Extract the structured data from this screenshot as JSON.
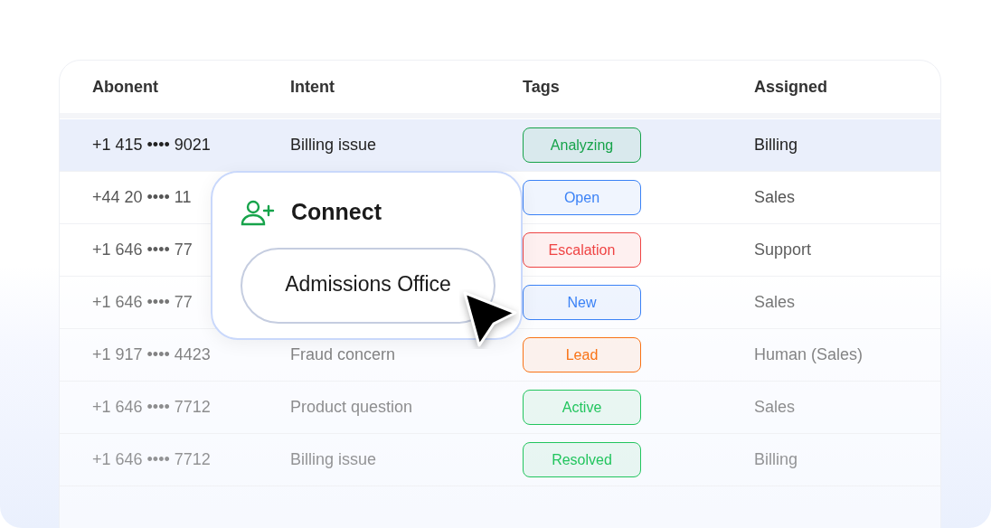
{
  "table": {
    "columns": [
      "Abonent",
      "Intent",
      "Tags",
      "Assigned"
    ],
    "rows": [
      {
        "abonent": "+1 415 •••• 9021",
        "intent": "Billing issue",
        "tag": "Analyzing",
        "color": "#16a34a",
        "assigned": "Billing",
        "selected": true
      },
      {
        "abonent": "+44 20 •••• 11",
        "tag": "Open",
        "color": "#3b82f6",
        "assigned": "Sales",
        "selected": false
      },
      {
        "abonent": "+1 646 •••• 77",
        "tag": "Escalation",
        "color": "#ef4444",
        "assigned": "Support",
        "selected": false
      },
      {
        "abonent": "+1 646 •••• 77",
        "tag": "New",
        "color": "#3b82f6",
        "assigned": "Sales",
        "selected": false
      },
      {
        "abonent": "+1 917 •••• 4423",
        "intent": "Fraud concern",
        "tag": "Lead",
        "color": "#f97316",
        "assigned": "Human (Sales)",
        "selected": false
      },
      {
        "abonent": "+1 646 •••• 7712",
        "intent": "Product question",
        "tag": "Active",
        "color": "#22c55e",
        "assigned": "Sales",
        "selected": false
      },
      {
        "abonent": "+1 646 •••• 7712",
        "intent": "Billing issue",
        "tag": "Resolved",
        "color": "#22c55e",
        "assigned": "Billing",
        "selected": false
      }
    ]
  },
  "popup": {
    "title": "Connect",
    "option": "Admissions Office"
  }
}
